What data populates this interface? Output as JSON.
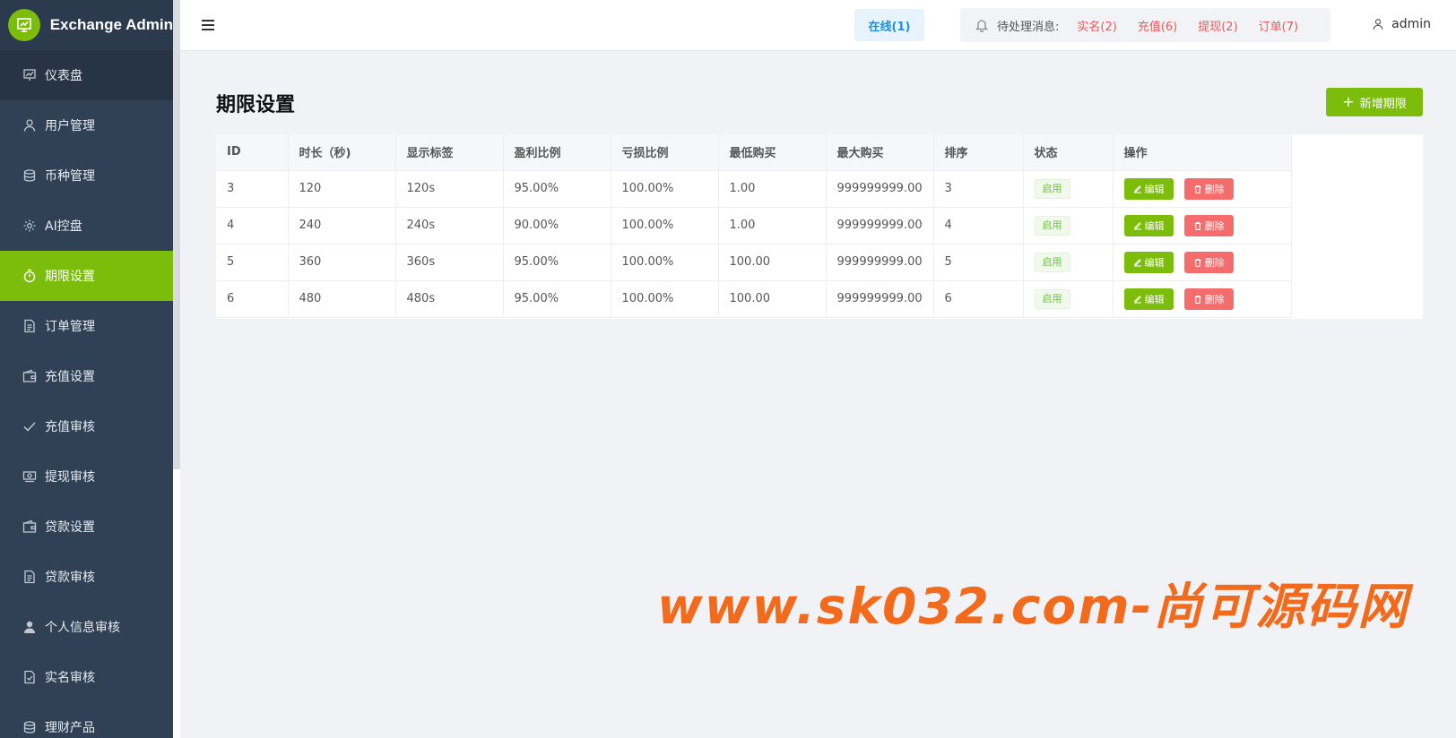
{
  "app": {
    "title": "Exchange Admin"
  },
  "sidebar": {
    "items": [
      {
        "label": "仪表盘",
        "icon": "dashboard-icon"
      },
      {
        "label": "用户管理",
        "icon": "user-icon"
      },
      {
        "label": "币种管理",
        "icon": "database-icon"
      },
      {
        "label": "AI控盘",
        "icon": "gear-icon"
      },
      {
        "label": "期限设置",
        "icon": "stopwatch-icon"
      },
      {
        "label": "订单管理",
        "icon": "document-icon"
      },
      {
        "label": "充值设置",
        "icon": "wallet-icon"
      },
      {
        "label": "充值审核",
        "icon": "check-icon"
      },
      {
        "label": "提现审核",
        "icon": "money-icon"
      },
      {
        "label": "贷款设置",
        "icon": "wallet-icon"
      },
      {
        "label": "贷款审核",
        "icon": "document-icon"
      },
      {
        "label": "个人信息审核",
        "icon": "person-icon"
      },
      {
        "label": "实名审核",
        "icon": "document-check-icon"
      },
      {
        "label": "理财产品",
        "icon": "database-icon"
      }
    ],
    "active_index": 4
  },
  "header": {
    "online": "在线(1)",
    "notice_label": "待处理消息:",
    "notices": [
      "实名(2)",
      "充值(6)",
      "提现(2)",
      "订单(7)"
    ],
    "user": "admin"
  },
  "page": {
    "title": "期限设置",
    "add_button": "新增期限"
  },
  "table": {
    "columns": [
      "ID",
      "时长（秒)",
      "显示标签",
      "盈利比例",
      "亏损比例",
      "最低购买",
      "最大购买",
      "排序",
      "状态",
      "操作"
    ],
    "rows": [
      {
        "id": "3",
        "duration": "120",
        "label": "120s",
        "profit": "95.00%",
        "loss": "100.00%",
        "min": "1.00",
        "max": "999999999.00",
        "sort": "3",
        "status": "启用"
      },
      {
        "id": "4",
        "duration": "240",
        "label": "240s",
        "profit": "90.00%",
        "loss": "100.00%",
        "min": "1.00",
        "max": "999999999.00",
        "sort": "4",
        "status": "启用"
      },
      {
        "id": "5",
        "duration": "360",
        "label": "360s",
        "profit": "95.00%",
        "loss": "100.00%",
        "min": "100.00",
        "max": "999999999.00",
        "sort": "5",
        "status": "启用"
      },
      {
        "id": "6",
        "duration": "480",
        "label": "480s",
        "profit": "95.00%",
        "loss": "100.00%",
        "min": "100.00",
        "max": "999999999.00",
        "sort": "6",
        "status": "启用"
      }
    ],
    "edit_label": "编辑",
    "delete_label": "删除"
  },
  "watermark": "www.sk032.com-尚可源码网",
  "colors": {
    "accent": "#7cbd0b",
    "sidebar": "#304156",
    "danger": "#f56c6c",
    "link": "#e65a5a",
    "online": "#1b8fe0",
    "watermark": "#f26a1b"
  }
}
